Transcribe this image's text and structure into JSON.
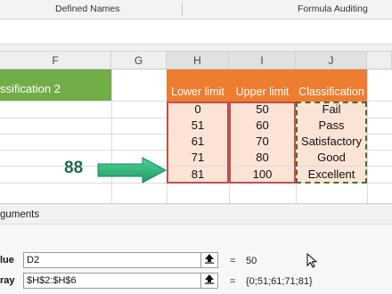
{
  "ribbon": {
    "groups": [
      "Defined Names",
      "Formula Auditing"
    ]
  },
  "sheet": {
    "columns": [
      "F",
      "G",
      "H",
      "I",
      "J"
    ],
    "f_header_text": "ssification 2",
    "table": {
      "headers": [
        "Lower limit",
        "Upper limit",
        "Classification"
      ],
      "rows": [
        [
          "0",
          "50",
          "Fail"
        ],
        [
          "51",
          "60",
          "Pass"
        ],
        [
          "61",
          "70",
          "Satisfactory"
        ],
        [
          "71",
          "80",
          "Good"
        ],
        [
          "81",
          "100",
          "Excellent"
        ]
      ]
    },
    "annotation_value": "88",
    "colors": {
      "green": "#70ad47",
      "orange": "#ed7d31",
      "pink": "#fbe3d6"
    }
  },
  "dialog": {
    "title": "guments",
    "args": [
      {
        "label": "lue",
        "value": "D2",
        "result": "50"
      },
      {
        "label": "ray",
        "value": "$H$2:$H$6",
        "result": "{0;51;61;71;81}"
      }
    ],
    "equals": "="
  }
}
